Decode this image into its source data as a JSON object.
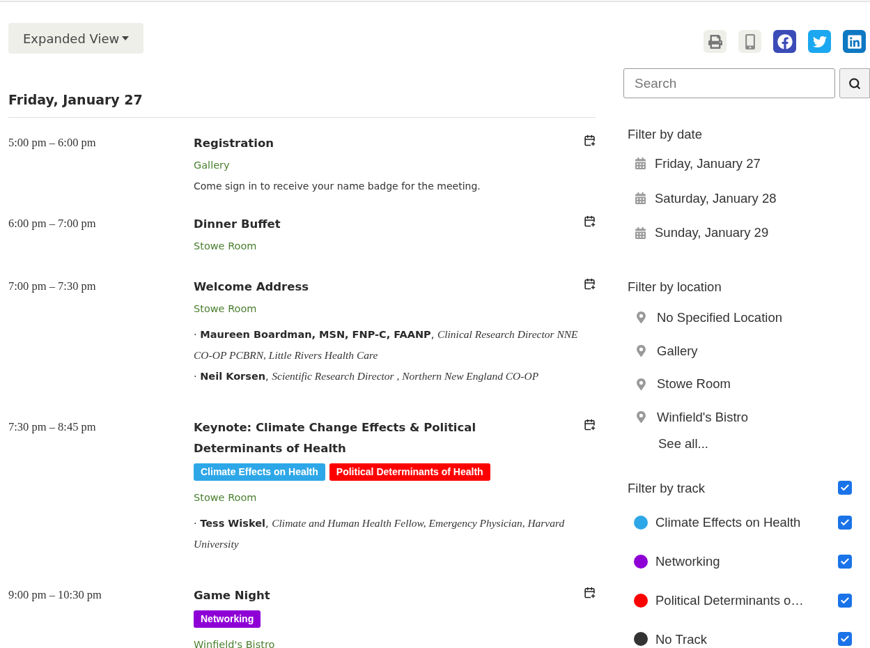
{
  "view_button": {
    "label": "Expanded View"
  },
  "day": {
    "heading": "Friday, January 27"
  },
  "events": [
    {
      "time": "5:00 pm – 6:00 pm",
      "title": "Registration",
      "location": "Gallery",
      "description": "Come sign in to receive your name badge for the meeting."
    },
    {
      "time": "6:00 pm – 7:00 pm",
      "title": "Dinner Buffet",
      "location": "Stowe Room"
    },
    {
      "time": "7:00 pm – 7:30 pm",
      "title": "Welcome Address",
      "location": "Stowe Room",
      "speakers": [
        "· **Maureen Boardman, MSN, FNP-C, FAANP**, *Clinical Research Director NNE CO-OP PCBRN, Little Rivers Health Care*",
        "· **Neil Korsen**, *Scientific Research Director , Northern New England CO-OP*"
      ]
    },
    {
      "time": "7:30 pm – 8:45 pm",
      "title": "Keynote: Climate Change Effects & Political Determinants of Health",
      "tags": [
        {
          "label": "Climate Effects on Health",
          "color": "#2ea7e8"
        },
        {
          "label": "Political Determinants of Health",
          "color": "#ff0000"
        }
      ],
      "location": "Stowe Room",
      "speakers": [
        "· **Tess Wiskel**, *Climate and Human Health Fellow, Emergency Physician, Harvard University*"
      ]
    },
    {
      "time": "9:00 pm – 10:30 pm",
      "title": "Game Night",
      "tags": [
        {
          "label": "Networking",
          "color": "#8e00d6"
        }
      ],
      "location": "Winfield's Bistro"
    }
  ],
  "share_buttons": [
    {
      "kind": "print"
    },
    {
      "kind": "mobile"
    },
    {
      "kind": "facebook"
    },
    {
      "kind": "twitter"
    },
    {
      "kind": "linkedin"
    }
  ],
  "search": {
    "placeholder": "Search"
  },
  "date_filter": {
    "heading": "Filter by date",
    "items": [
      "Friday, January 27",
      "Saturday, January 28",
      "Sunday, January 29"
    ]
  },
  "location_filter": {
    "heading": "Filter by location",
    "items": [
      "No Specified Location",
      "Gallery",
      "Stowe Room",
      "Winfield's Bistro"
    ],
    "see_all": "See all..."
  },
  "track_filter": {
    "heading": "Filter by track",
    "checked": true,
    "items": [
      {
        "label": "Climate Effects on Health",
        "color": "#2ea7e8",
        "checked": true
      },
      {
        "label": "Networking",
        "color": "#8e00d6",
        "checked": true
      },
      {
        "label": "Political Determinants o…",
        "color": "#ff0000",
        "checked": true
      },
      {
        "label": "No Track",
        "color": "#333333",
        "checked": true
      }
    ]
  }
}
